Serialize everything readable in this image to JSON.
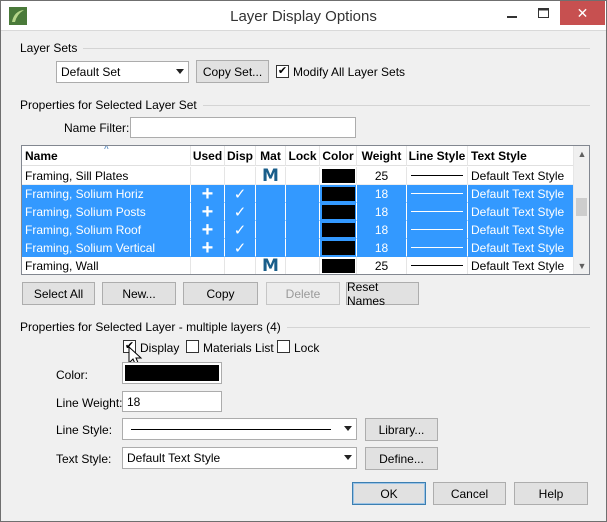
{
  "window": {
    "title": "Layer Display Options"
  },
  "layer_sets": {
    "group_label": "Layer Sets",
    "selected": "Default Set",
    "copy_set_label": "Copy Set...",
    "modify_all_label": "Modify All Layer Sets",
    "modify_all_checked": true
  },
  "properties_set": {
    "group_label": "Properties for Selected Layer Set",
    "name_filter_label": "Name Filter:",
    "name_filter_value": ""
  },
  "table": {
    "columns": [
      "Name",
      "Used",
      "Disp",
      "Mat",
      "Lock",
      "Color",
      "Weight",
      "Line Style",
      "Text Style"
    ],
    "rows": [
      {
        "name": "Framing, Sill Plates",
        "used": "",
        "disp": "",
        "mat": "M",
        "lock": "",
        "color": "#000000",
        "weight": "25",
        "line_style": "solid",
        "text_style": "Default Text Style",
        "selected": false
      },
      {
        "name": "Framing, Solium Horiz",
        "used": "+",
        "disp": "✓",
        "mat": "",
        "lock": "",
        "color": "#000000",
        "weight": "18",
        "line_style": "solid",
        "text_style": "Default Text Style",
        "selected": true
      },
      {
        "name": "Framing, Solium Posts",
        "used": "+",
        "disp": "✓",
        "mat": "",
        "lock": "",
        "color": "#000000",
        "weight": "18",
        "line_style": "solid",
        "text_style": "Default Text Style",
        "selected": true
      },
      {
        "name": "Framing, Solium Roof",
        "used": "+",
        "disp": "✓",
        "mat": "",
        "lock": "",
        "color": "#000000",
        "weight": "18",
        "line_style": "solid",
        "text_style": "Default Text Style",
        "selected": true
      },
      {
        "name": "Framing, Solium Vertical",
        "used": "+",
        "disp": "✓",
        "mat": "",
        "lock": "",
        "color": "#000000",
        "weight": "18",
        "line_style": "solid",
        "text_style": "Default Text Style",
        "selected": true
      },
      {
        "name": "Framing, Wall",
        "used": "",
        "disp": "",
        "mat": "M",
        "lock": "",
        "color": "#000000",
        "weight": "25",
        "line_style": "solid",
        "text_style": "Default Text Style",
        "selected": false
      }
    ]
  },
  "table_buttons": {
    "select_all": "Select All",
    "new": "New...",
    "copy": "Copy",
    "delete": "Delete",
    "reset_names": "Reset Names"
  },
  "properties_layer": {
    "group_label": "Properties for Selected Layer - multiple layers (4)",
    "display_label": "Display",
    "display_checked": true,
    "materials_label": "Materials List",
    "materials_checked": false,
    "lock_label": "Lock",
    "lock_checked": false,
    "color_label": "Color:",
    "color_value": "#000000",
    "line_weight_label": "Line Weight:",
    "line_weight_value": "18",
    "line_style_label": "Line Style:",
    "library_label": "Library...",
    "text_style_label": "Text Style:",
    "text_style_value": "Default Text Style",
    "define_label": "Define..."
  },
  "footer": {
    "ok": "OK",
    "cancel": "Cancel",
    "help": "Help"
  },
  "colors": {
    "selection": "#3399ff",
    "mat_icon": "#1a5e8a",
    "close_button": "#c75050"
  }
}
